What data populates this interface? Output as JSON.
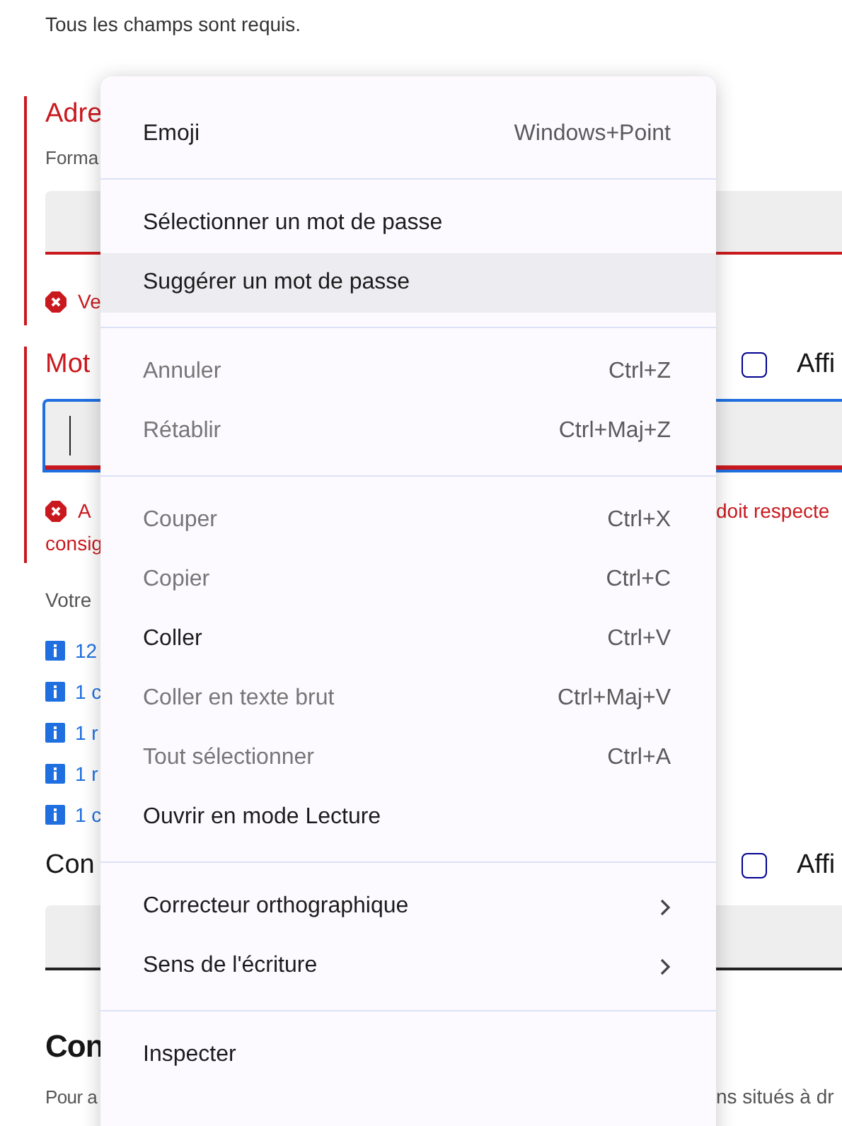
{
  "intro": "Tous les champs sont requis.",
  "email": {
    "label": "Adre",
    "hint": "Forma",
    "error": "Ve"
  },
  "password": {
    "label": "Mot",
    "show_label": "Affi",
    "show_checked": false,
    "focused": true,
    "error_start": "A",
    "error_end": "doit respecte",
    "error_line2": "consig",
    "rules_intro": "Votre",
    "rules": [
      "12",
      "1 c",
      "1 r",
      "1 r",
      "1 c"
    ]
  },
  "confirm": {
    "label": "Con",
    "show_label": "Affi",
    "show_checked": false
  },
  "section": {
    "title": "Con",
    "text_start": "Pour a",
    "text_end": "ns situés à dr"
  },
  "menu": [
    {
      "kind": "item",
      "label": "Emoji",
      "shortcut": "Windows+Point",
      "disabled": false,
      "selected": false
    },
    {
      "kind": "separator"
    },
    {
      "kind": "item",
      "label": "Sélectionner un mot de passe",
      "disabled": false,
      "selected": false
    },
    {
      "kind": "item",
      "label": "Suggérer un mot de passe",
      "disabled": false,
      "selected": true
    },
    {
      "kind": "separator"
    },
    {
      "kind": "item",
      "label": "Annuler",
      "shortcut": "Ctrl+Z",
      "disabled": true,
      "selected": false
    },
    {
      "kind": "item",
      "label": "Rétablir",
      "shortcut": "Ctrl+Maj+Z",
      "disabled": true,
      "selected": false
    },
    {
      "kind": "separator"
    },
    {
      "kind": "item",
      "label": "Couper",
      "shortcut": "Ctrl+X",
      "disabled": true,
      "selected": false
    },
    {
      "kind": "item",
      "label": "Copier",
      "shortcut": "Ctrl+C",
      "disabled": true,
      "selected": false
    },
    {
      "kind": "item",
      "label": "Coller",
      "shortcut": "Ctrl+V",
      "disabled": false,
      "selected": false
    },
    {
      "kind": "item",
      "label": "Coller en texte brut",
      "shortcut": "Ctrl+Maj+V",
      "disabled": true,
      "selected": false
    },
    {
      "kind": "item",
      "label": "Tout sélectionner",
      "shortcut": "Ctrl+A",
      "disabled": true,
      "selected": false
    },
    {
      "kind": "item",
      "label": "Ouvrir en mode Lecture",
      "disabled": false,
      "selected": false
    },
    {
      "kind": "separator"
    },
    {
      "kind": "submenu",
      "label": "Correcteur orthographique",
      "disabled": false,
      "selected": false
    },
    {
      "kind": "submenu",
      "label": "Sens de l'écriture",
      "disabled": false,
      "selected": false
    },
    {
      "kind": "separator"
    },
    {
      "kind": "item",
      "label": "Inspecter",
      "disabled": false,
      "selected": false
    }
  ]
}
